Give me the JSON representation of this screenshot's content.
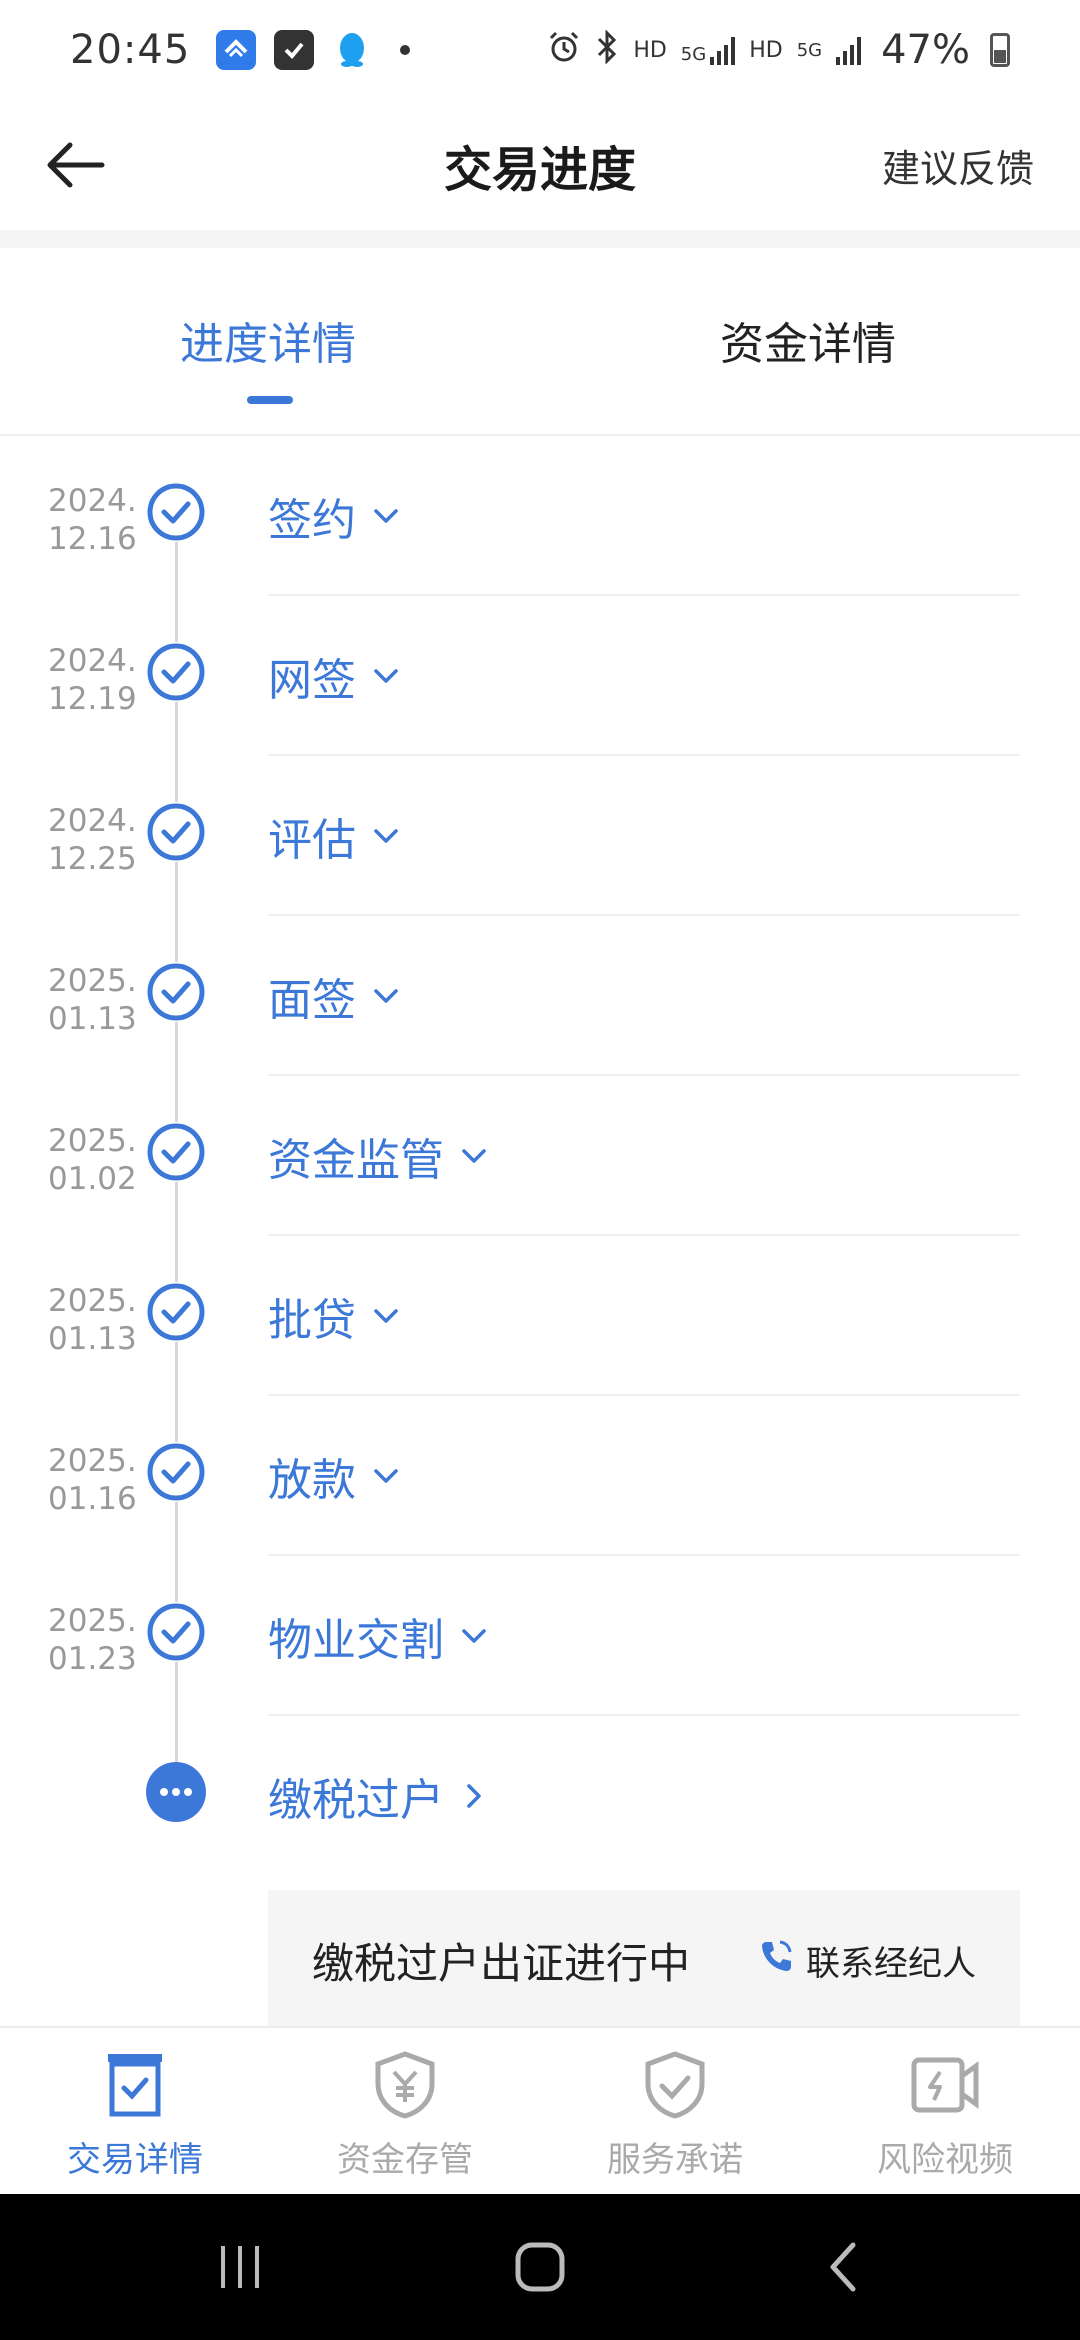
{
  "status_bar": {
    "time": "20:45",
    "icons": [
      "vpn-app-icon",
      "checkbox-app-icon",
      "qq-icon",
      "notification-dot",
      "alarm-icon",
      "bluetooth-icon",
      "hd-icon",
      "5g-signal-icon",
      "hd-icon",
      "5g-data-icon",
      "signal-icon",
      "battery-icon"
    ],
    "hd1": "HD",
    "net1": "5G",
    "hd2": "HD",
    "net2": "5G",
    "battery": "47%"
  },
  "header": {
    "title": "交易进度",
    "feedback_label": "建议反馈"
  },
  "tabs": [
    {
      "label": "进度详情",
      "active": true
    },
    {
      "label": "资金详情",
      "active": false
    }
  ],
  "timeline": [
    {
      "date_year": "2024.",
      "date_md": "12.16",
      "label": "签约",
      "status": "done"
    },
    {
      "date_year": "2024.",
      "date_md": "12.19",
      "label": "网签",
      "status": "done"
    },
    {
      "date_year": "2024.",
      "date_md": "12.25",
      "label": "评估",
      "status": "done"
    },
    {
      "date_year": "2025.",
      "date_md": "01.13",
      "label": "面签",
      "status": "done"
    },
    {
      "date_year": "2025.",
      "date_md": "01.02",
      "label": "资金监管",
      "status": "done"
    },
    {
      "date_year": "2025.",
      "date_md": "01.13",
      "label": "批贷",
      "status": "done"
    },
    {
      "date_year": "2025.",
      "date_md": "01.16",
      "label": "放款",
      "status": "done"
    },
    {
      "date_year": "2025.",
      "date_md": "01.23",
      "label": "物业交割",
      "status": "done"
    },
    {
      "date_year": "",
      "date_md": "",
      "label": "缴税过户",
      "status": "in-progress"
    }
  ],
  "current_status": {
    "text": "缴税过户出证进行中",
    "contact_label": "联系经纪人"
  },
  "bottom_nav": [
    {
      "label": "交易详情",
      "icon": "transaction-detail-icon",
      "active": true
    },
    {
      "label": "资金存管",
      "icon": "fund-custody-shield-icon",
      "active": false
    },
    {
      "label": "服务承诺",
      "icon": "service-promise-shield-icon",
      "active": false
    },
    {
      "label": "风险视频",
      "icon": "risk-video-icon",
      "active": false
    }
  ],
  "colors": {
    "accent": "#3c78d8",
    "muted": "#999999",
    "divider": "#f0f0f0"
  }
}
